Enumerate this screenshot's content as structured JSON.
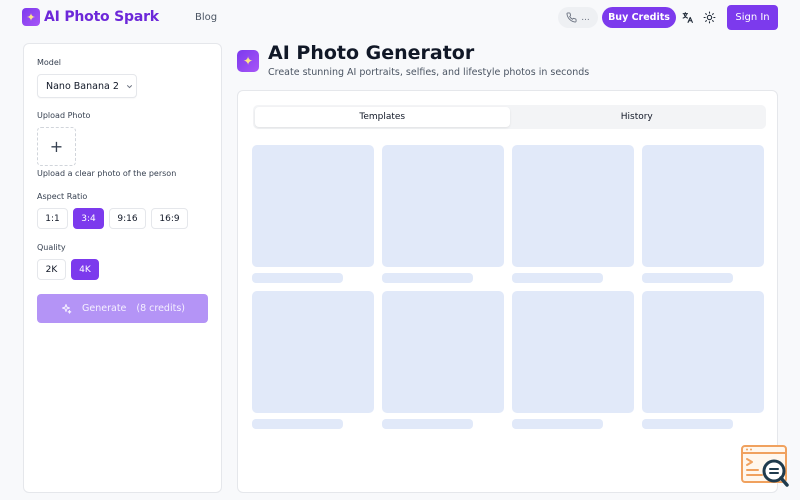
{
  "header": {
    "brand": "AI Photo Spark",
    "nav": {
      "blog": "Blog"
    },
    "language_pill": {
      "dots": "..."
    },
    "buy_credits": "Buy Credits",
    "sign_in": "Sign In"
  },
  "left_panel": {
    "model_label": "Model",
    "model_value": "Nano Banana 2",
    "upload_label": "Upload Photo",
    "upload_hint": "Upload a clear photo of the person",
    "aspect_label": "Aspect Ratio",
    "aspect_options": [
      "1:1",
      "3:4",
      "9:16",
      "16:9"
    ],
    "aspect_selected": "3:4",
    "quality_label": "Quality",
    "quality_options": [
      "2K",
      "4K"
    ],
    "quality_selected": "4K",
    "generate_label": "Generate",
    "generate_credits": "(8 credits)"
  },
  "main": {
    "title": "AI Photo Generator",
    "subtitle": "Create stunning AI portraits, selfies, and lifestyle photos in seconds",
    "tabs": [
      {
        "label": "Templates",
        "active": true
      },
      {
        "label": "History",
        "active": false
      }
    ]
  },
  "colors": {
    "accent": "#7c3aed",
    "accent_disabled": "#b494f6",
    "skeleton": "#e1e9f9"
  },
  "icons": {
    "logo": "sparkles-icon",
    "language": "translate-icon",
    "theme": "sun-icon",
    "generate": "sparkles-icon",
    "upload": "plus-icon"
  }
}
